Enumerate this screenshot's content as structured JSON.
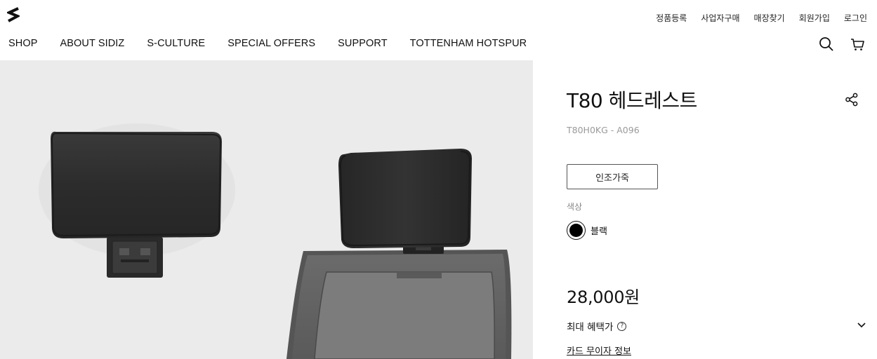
{
  "header": {
    "logo_icon": "sidiz-s-logo-icon",
    "util_nav": [
      "정품등록",
      "사업자구매",
      "매장찾기",
      "회원가입",
      "로그인"
    ],
    "main_nav": [
      "SHOP",
      "ABOUT SIDIZ",
      "S-CULTURE",
      "SPECIAL OFFERS",
      "SUPPORT",
      "TOTTENHAM HOTSPUR"
    ],
    "icons": {
      "search": "search-icon",
      "cart": "cart-icon"
    }
  },
  "gallery": {
    "images": [
      "headrest-standalone",
      "headrest-mounted-on-chair"
    ],
    "background": "#ebebeb"
  },
  "product": {
    "title": "T80 헤드레스트",
    "sku": "T80H0KG - A096",
    "tag_button": "인조가죽",
    "color_label": "색상",
    "color_name": "블랙",
    "color_hex": "#000000",
    "price": "28,000원",
    "benefit_label": "최대 혜택가",
    "card_link": "카드 무이자 정보",
    "share_icon": "share-icon"
  }
}
